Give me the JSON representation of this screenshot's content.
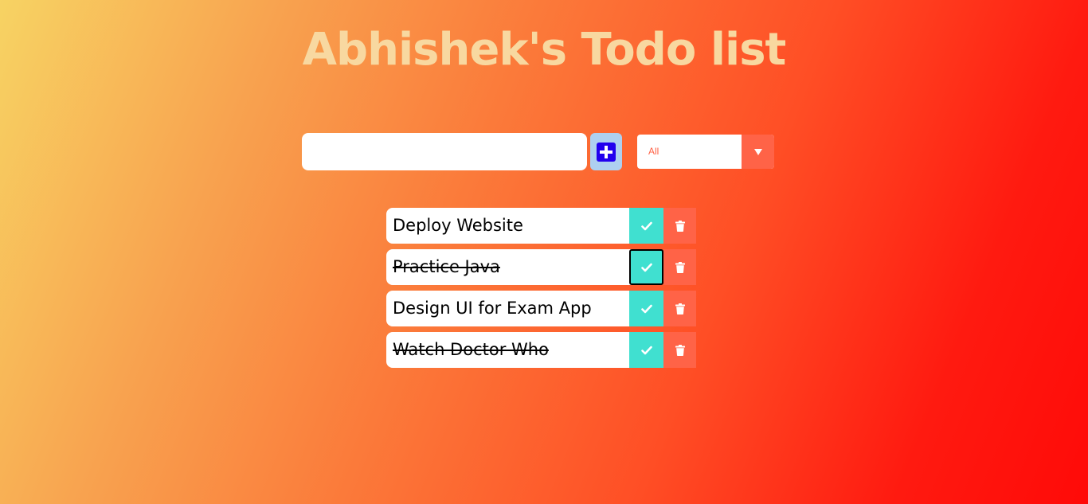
{
  "header": {
    "title": "Abhishek's Todo list"
  },
  "form": {
    "input_value": "",
    "add_icon": "plus-square-icon",
    "filter": {
      "selected": "All",
      "caret_icon": "caret-down-icon"
    }
  },
  "todos": [
    {
      "text": "Deploy Website",
      "completed": false
    },
    {
      "text": "Practice Java",
      "completed": true
    },
    {
      "text": "Design UI for Exam App",
      "completed": false
    },
    {
      "text": "Watch Doctor Who",
      "completed": true
    }
  ],
  "colors": {
    "accent": "#ff6347",
    "check": "#40e0d0",
    "title": "#f8d8a0",
    "add_button_bg": "#aed0f0",
    "add_icon": "#2200ee"
  }
}
